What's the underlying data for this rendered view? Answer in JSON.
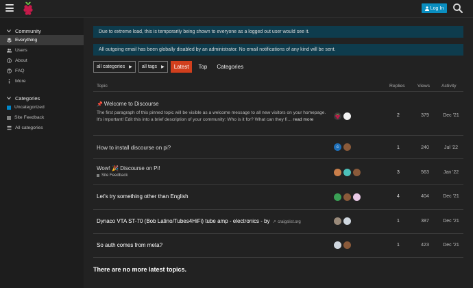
{
  "header": {
    "logo": "raspberry-pi-logo",
    "login_label": "Log In",
    "menu_icon": "hamburger-icon",
    "search_icon": "search-icon"
  },
  "sidebar": {
    "community_heading": "Community",
    "community_items": [
      {
        "label": "Everything",
        "icon": "stack-icon",
        "active": true
      },
      {
        "label": "Users",
        "icon": "users-icon"
      },
      {
        "label": "About",
        "icon": "info-icon"
      },
      {
        "label": "FAQ",
        "icon": "question-icon"
      },
      {
        "label": "More",
        "icon": "more-icon"
      }
    ],
    "categories_heading": "Categories",
    "category_items": [
      {
        "label": "Uncategorized",
        "color": "#0088cc"
      },
      {
        "label": "Site Feedback",
        "color": "#808281"
      },
      {
        "label": "All categories",
        "icon": "list-icon"
      }
    ]
  },
  "banners": {
    "load_notice": "Due to extreme load, this is temporarily being shown to everyone as a logged out user would see it.",
    "email_notice": "All outgoing email has been globally disabled by an administrator. No email notifications of any kind will be sent."
  },
  "filters": {
    "categories_label": "all categories",
    "tags_label": "all tags",
    "nav": [
      "Latest",
      "Top",
      "Categories"
    ]
  },
  "table": {
    "headers": {
      "topic": "Topic",
      "replies": "Replies",
      "views": "Views",
      "activity": "Activity"
    },
    "topics": [
      {
        "title": "Welcome to Discourse",
        "pinned": true,
        "excerpt": "The first paragraph of this pinned topic will be visible as a welcome message to all new visitors on your homepage. It's important! Edit this into a brief description of your community: Who is it for? What can they fi…",
        "read_more": "read more",
        "replies": "2",
        "views": "379",
        "activity": "Dec '21"
      },
      {
        "title": "How to install discourse on pi?",
        "replies": "1",
        "views": "240",
        "activity": "Jul '22"
      },
      {
        "title": "Wow! 🎉 Discourse on Pi!",
        "category": "Site Feedback",
        "replies": "3",
        "views": "563",
        "activity": "Jan '22"
      },
      {
        "title": "Let's try something other than English",
        "replies": "4",
        "views": "404",
        "activity": "Dec '21"
      },
      {
        "title": "Dynaco VTA ST-70 (Bob Latino/Tubes4HiFi) tube amp - electronics - by",
        "domain": "craigslist.org",
        "replies": "1",
        "views": "387",
        "activity": "Dec '21"
      },
      {
        "title": "So auth comes from meta?",
        "replies": "1",
        "views": "423",
        "activity": "Dec '21"
      }
    ]
  },
  "footer": {
    "message": "There are no more latest topics."
  },
  "colors": {
    "accent": "#d13f1d",
    "login": "#0a8ec0",
    "banner": "#0e3c4d"
  }
}
